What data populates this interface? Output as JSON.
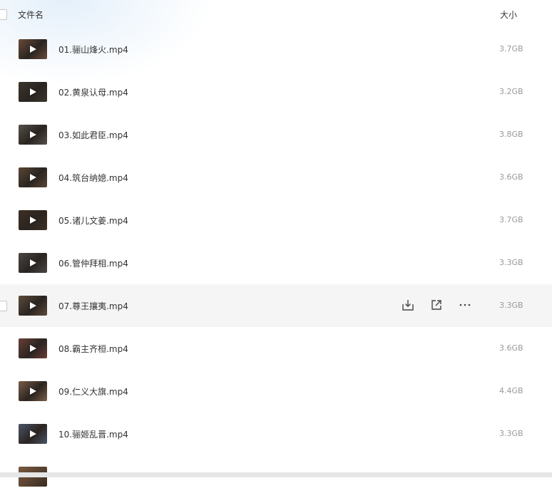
{
  "header": {
    "name_label": "文件名",
    "size_label": "大小"
  },
  "files": [
    {
      "name": "01.骊山烽火.mp4",
      "size": "3.7GB",
      "thumb_color": "#6b4a3a"
    },
    {
      "name": "02.黄泉认母.mp4",
      "size": "3.2GB",
      "thumb_color": "#3b352e"
    },
    {
      "name": "03.如此君臣.mp4",
      "size": "3.8GB",
      "thumb_color": "#56504a"
    },
    {
      "name": "04.筑台纳媳.mp4",
      "size": "3.6GB",
      "thumb_color": "#5a4634"
    },
    {
      "name": "05.诸儿文姜.mp4",
      "size": "3.7GB",
      "thumb_color": "#3e2f24"
    },
    {
      "name": "06.管仲拜相.mp4",
      "size": "3.3GB",
      "thumb_color": "#4a4744"
    },
    {
      "name": "07.尊王攘夷.mp4",
      "size": "3.3GB",
      "thumb_color": "#5e4b3a"
    },
    {
      "name": "08.霸主齐桓.mp4",
      "size": "3.6GB",
      "thumb_color": "#6a3f36"
    },
    {
      "name": "09.仁义大旗.mp4",
      "size": "4.4GB",
      "thumb_color": "#7a5e48"
    },
    {
      "name": "10.骊姬乱晋.mp4",
      "size": "3.3GB",
      "thumb_color": "#4b5568"
    }
  ],
  "hovered_index": 6
}
